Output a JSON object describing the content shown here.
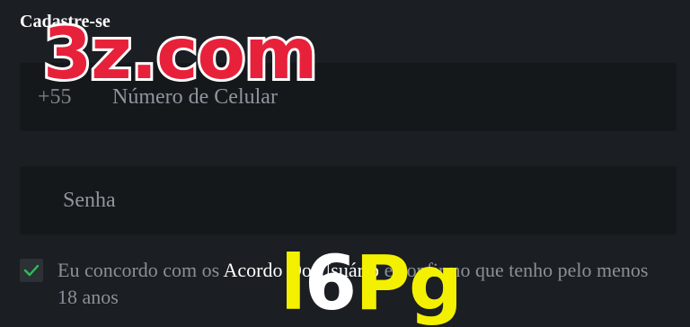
{
  "header": {
    "title": "Cadastre-se"
  },
  "watermarks": {
    "main": "3z.com",
    "code_prefix": "l",
    "code_white": "6",
    "code_suffix": "Pg"
  },
  "form": {
    "phone": {
      "prefix": "+55",
      "placeholder": "Número de Celular",
      "value": ""
    },
    "password": {
      "placeholder": "Senha",
      "value": ""
    },
    "agreement": {
      "checked": true,
      "text_before": "Eu concordo com os ",
      "link_label": "Acordo Do Usuário",
      "text_after": " e confirmo que tenho pelo menos 18 anos"
    }
  },
  "colors": {
    "background": "#1b1e22",
    "field_background": "#15181b",
    "check_mark": "#2ebd59",
    "watermark_red": "#e8213b",
    "watermark_yellow": "#f4f100"
  },
  "icons": {
    "checkbox": "check-icon"
  }
}
